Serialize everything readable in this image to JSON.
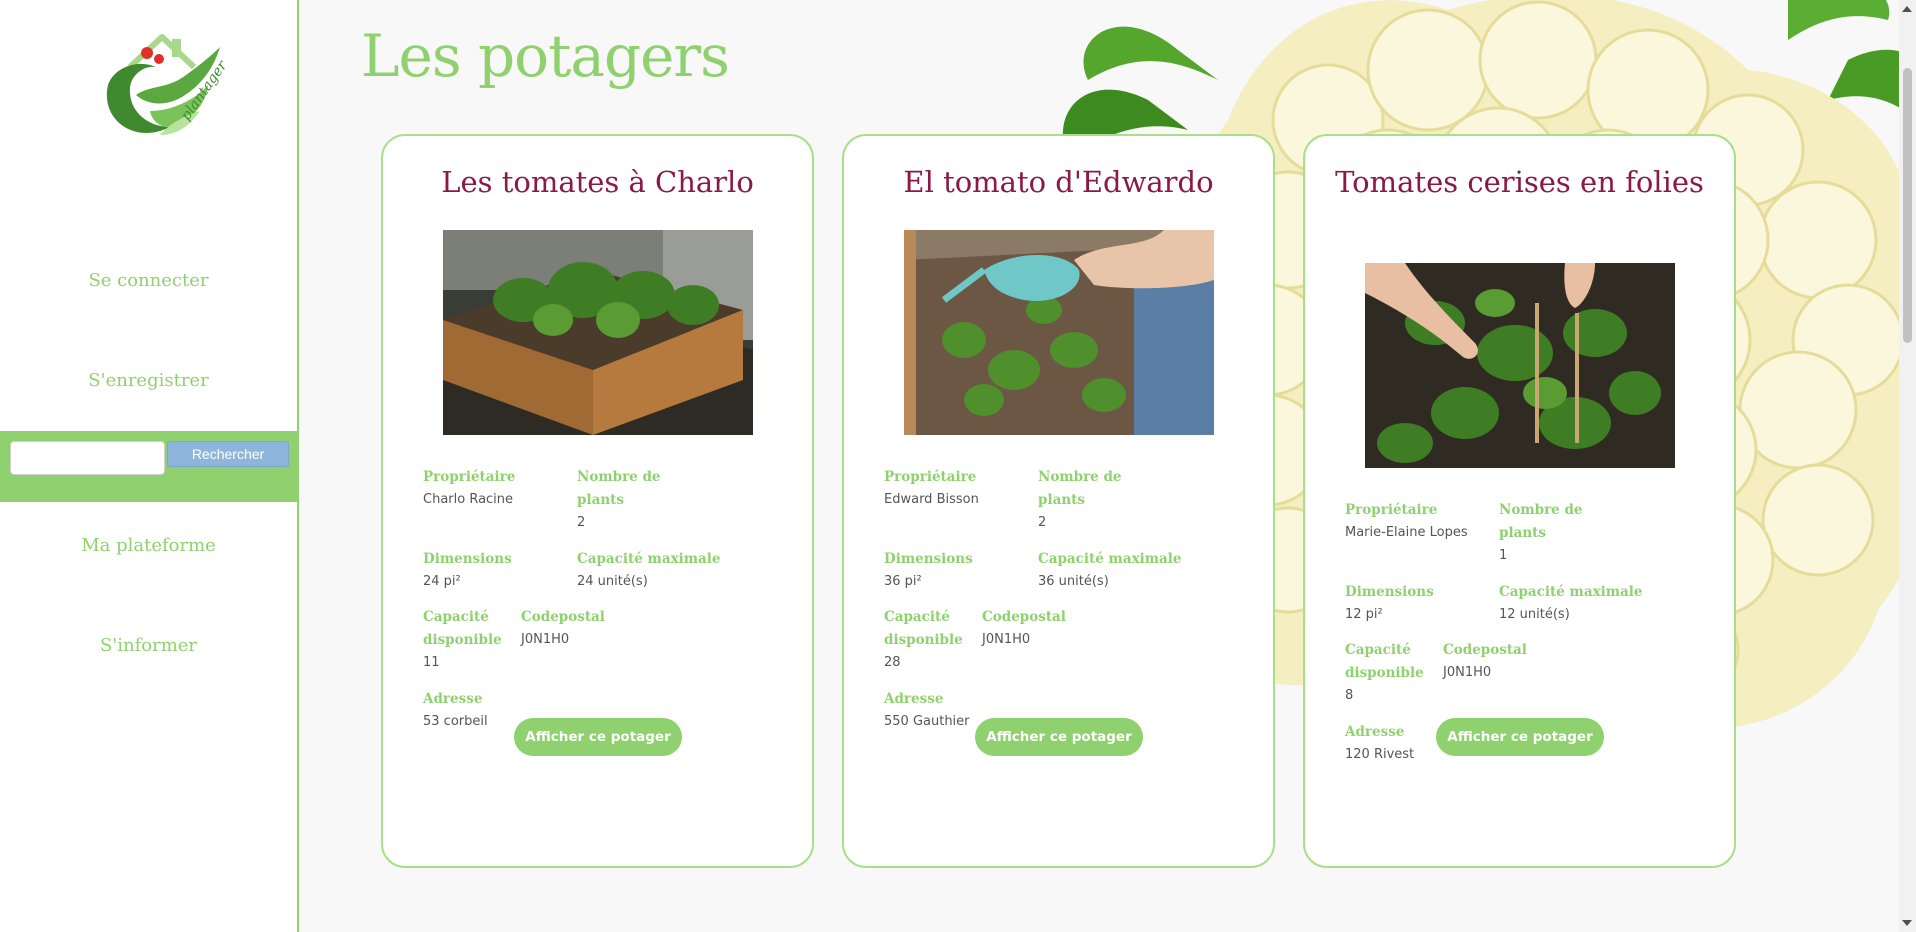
{
  "brand": {
    "logo_text": "plantager"
  },
  "nav": {
    "login": "Se connecter",
    "register": "S'enregistrer",
    "platform": "Ma plateforme",
    "inform": "S'informer"
  },
  "search": {
    "value": "",
    "button": "Rechercher"
  },
  "main": {
    "title": "Les potagers"
  },
  "labels": {
    "owner": "Propriétaire",
    "plants": "Nombre de plants",
    "dimensions": "Dimensions",
    "max_capacity": "Capacité maximale",
    "available": "Capacité disponible",
    "postal": "Codepostal",
    "address": "Adresse",
    "show_button": "Afficher ce potager"
  },
  "gardens": [
    {
      "title": "Les tomates à Charlo",
      "owner": "Charlo Racine",
      "plants": "2",
      "dimensions": "24 pi²",
      "max_capacity": "24 unité(s)",
      "available": "11",
      "postal": "J0N1H0",
      "address": "53 corbeil"
    },
    {
      "title": "El tomato d'Edwardo",
      "owner": "Edward Bisson",
      "plants": "2",
      "dimensions": "36 pi²",
      "max_capacity": "36 unité(s)",
      "available": "28",
      "postal": "J0N1H0",
      "address": "550 Gauthier"
    },
    {
      "title": "Tomates cerises en folies",
      "owner": "Marie-Elaine Lopes",
      "plants": "1",
      "dimensions": "12 pi²",
      "max_capacity": "12 unité(s)",
      "available": "8",
      "postal": "J0N1H0",
      "address": "120 Rivest"
    }
  ],
  "colors": {
    "accent": "#8fd16e",
    "card_title": "#8a1a45",
    "search_button": "#8eb6dd"
  }
}
